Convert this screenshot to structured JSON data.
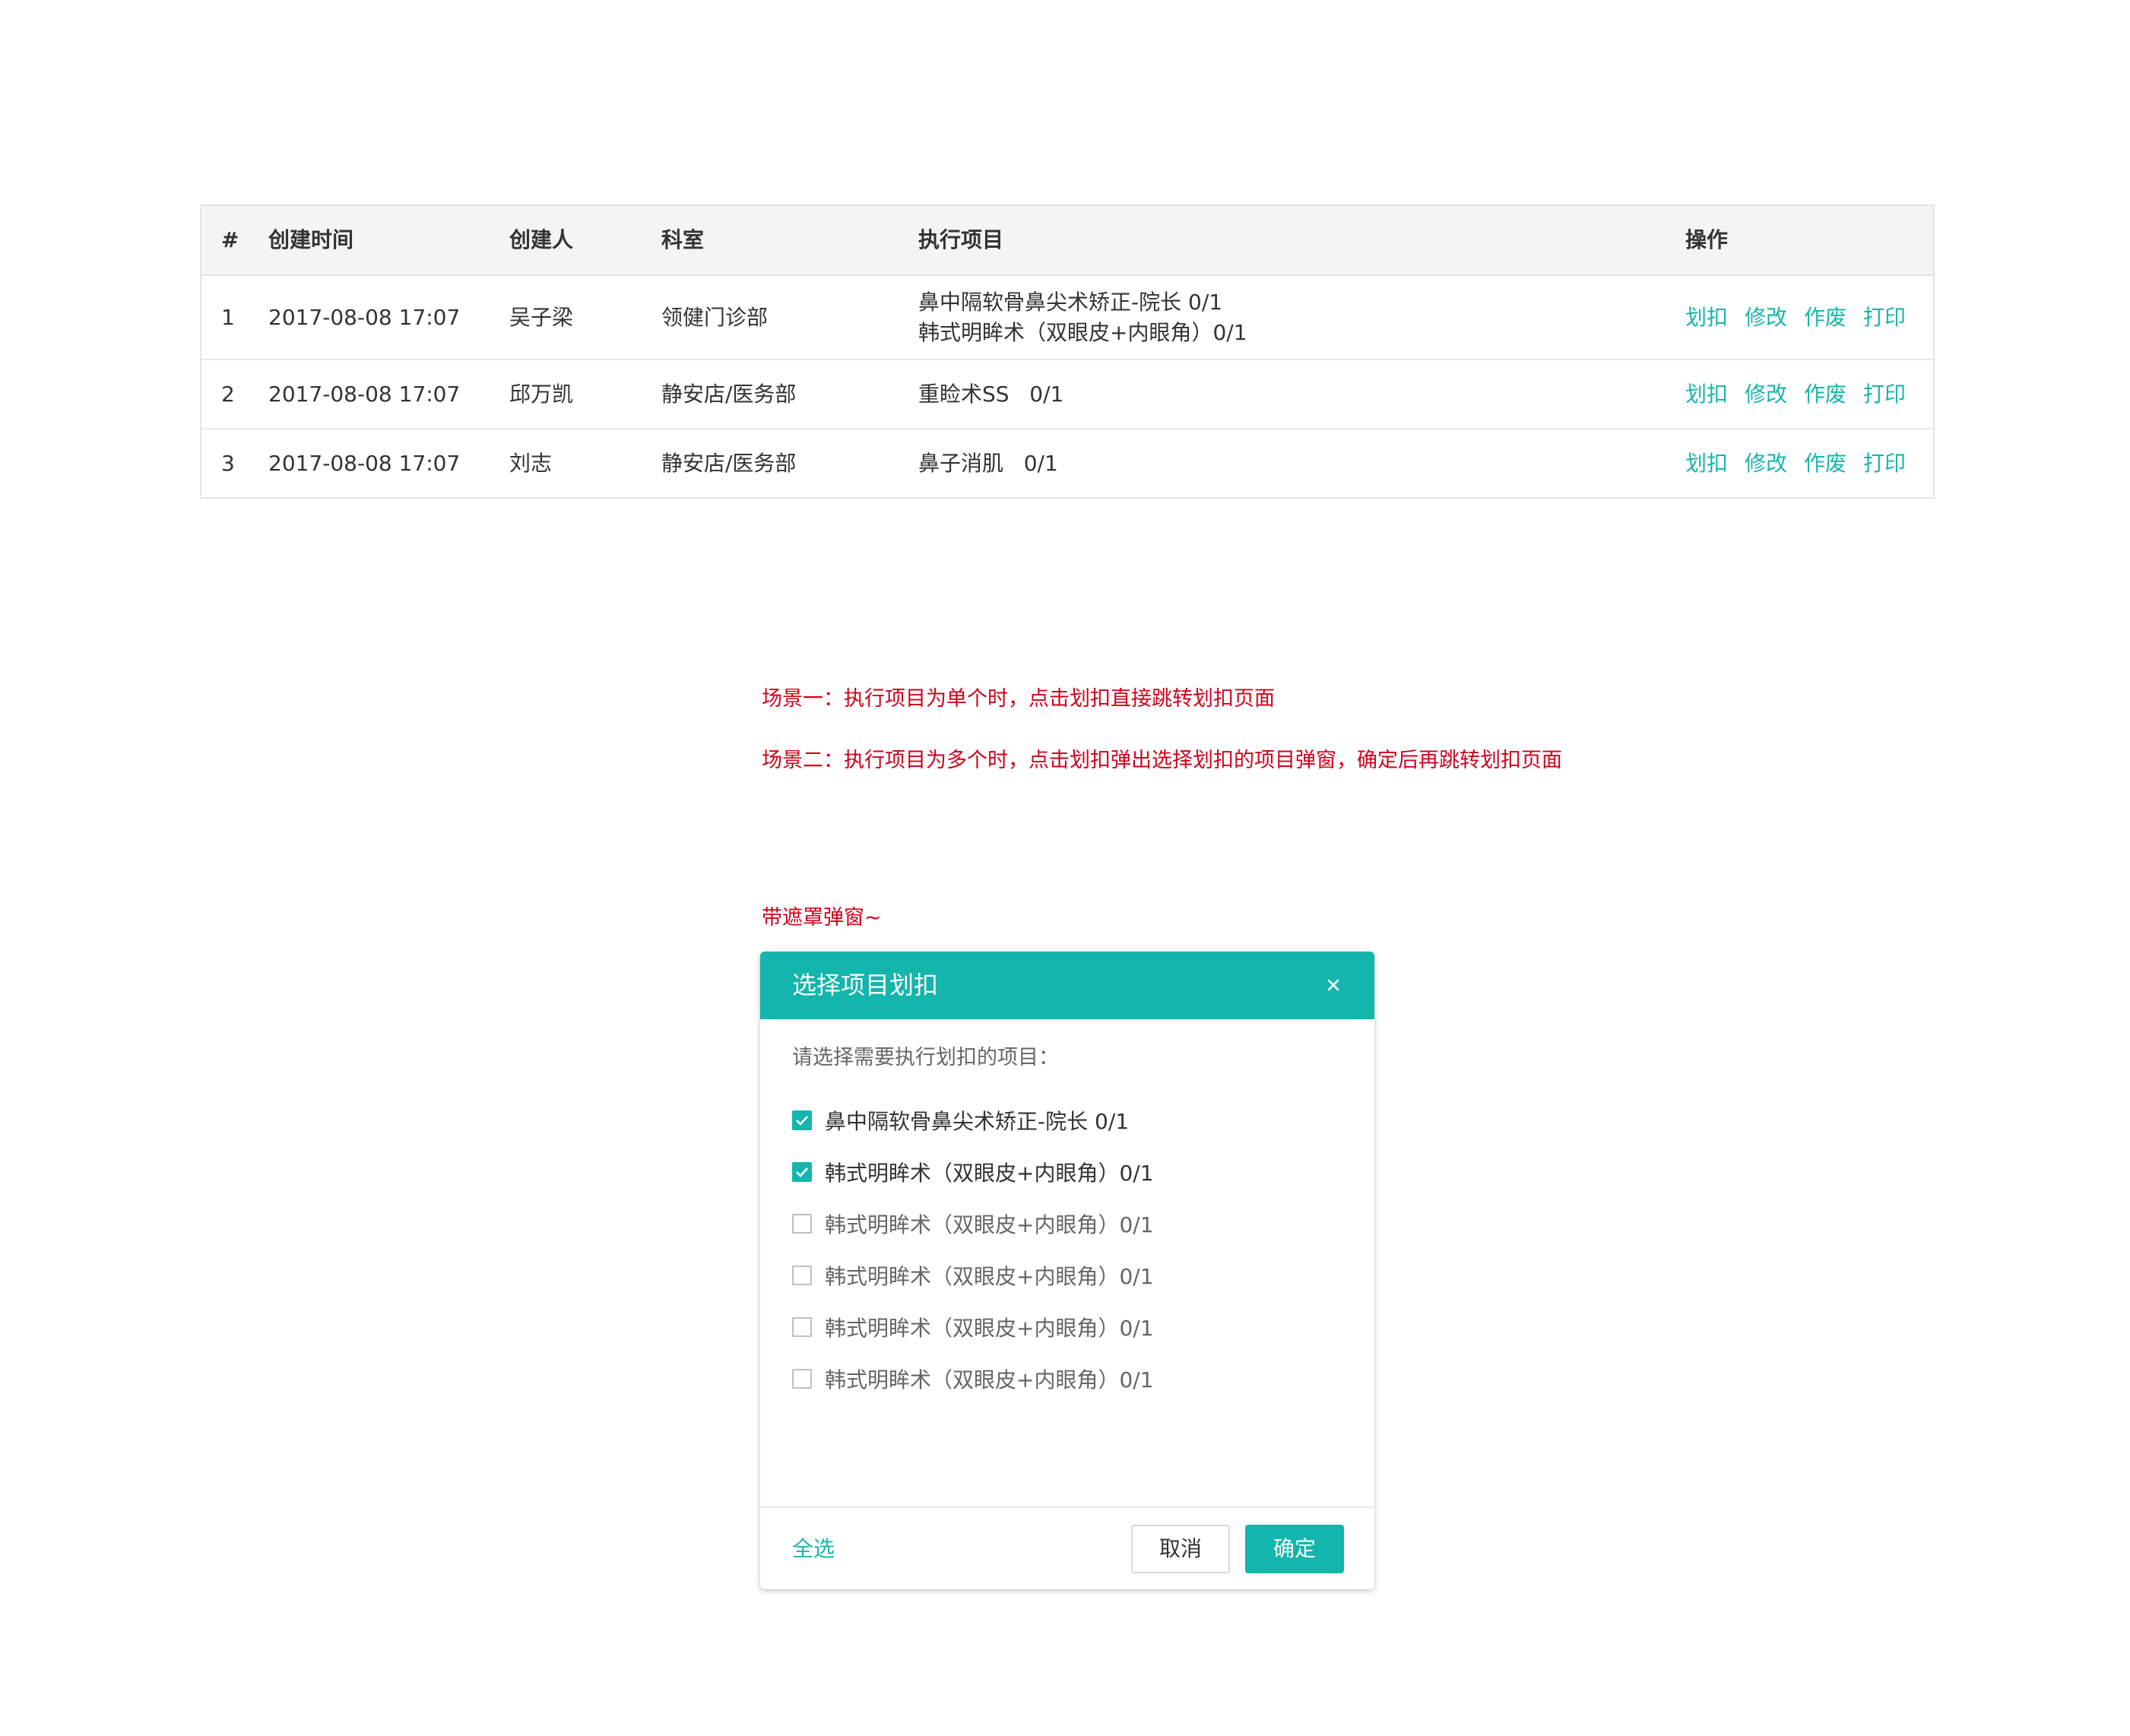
{
  "table": {
    "headers": [
      "#",
      "创建时间",
      "创建人",
      "科室",
      "执行项目",
      "操作"
    ],
    "rows": [
      {
        "idx": "1",
        "time": "2017-08-08 17:07",
        "creator": "吴子梁",
        "dept": "领健门诊部",
        "items": [
          "鼻中隔软骨鼻尖术矫正-院长 0/1",
          "韩式明眸术（双眼皮+内眼角）0/1"
        ],
        "ops": [
          "划扣",
          "修改",
          "作废",
          "打印"
        ]
      },
      {
        "idx": "2",
        "time": "2017-08-08 17:07",
        "creator": "邱万凯",
        "dept": "静安店/医务部",
        "items": [
          "重睑术SS   0/1"
        ],
        "ops": [
          "划扣",
          "修改",
          "作废",
          "打印"
        ]
      },
      {
        "idx": "3",
        "time": "2017-08-08 17:07",
        "creator": "刘志",
        "dept": "静安店/医务部",
        "items": [
          "鼻子消肌   0/1"
        ],
        "ops": [
          "划扣",
          "修改",
          "作废",
          "打印"
        ]
      }
    ]
  },
  "notes": {
    "scenario1": "场景一：执行项目为单个时，点击划扣直接跳转划扣页面",
    "scenario2": "场景二：执行项目为多个时，点击划扣弹出选择划扣的项目弹窗，确定后再跳转划扣页面",
    "modal_label": "带遮罩弹窗~"
  },
  "modal": {
    "title": "选择项目划扣",
    "close_icon": "close-icon",
    "prompt": "请选择需要执行划扣的项目：",
    "options": [
      {
        "label": "鼻中隔软骨鼻尖术矫正-院长 0/1",
        "checked": true
      },
      {
        "label": "韩式明眸术（双眼皮+内眼角）0/1",
        "checked": true
      },
      {
        "label": "韩式明眸术（双眼皮+内眼角）0/1",
        "checked": false
      },
      {
        "label": "韩式明眸术（双眼皮+内眼角）0/1",
        "checked": false
      },
      {
        "label": "韩式明眸术（双眼皮+内眼角）0/1",
        "checked": false
      },
      {
        "label": "韩式明眸术（双眼皮+内眼角）0/1",
        "checked": false
      }
    ],
    "select_all": "全选",
    "cancel": "取消",
    "confirm": "确定"
  },
  "colors": {
    "accent": "#13b5ac",
    "link": "#1ab5ac",
    "note_red": "#d0021b",
    "header_bg": "#f4f4f4"
  }
}
